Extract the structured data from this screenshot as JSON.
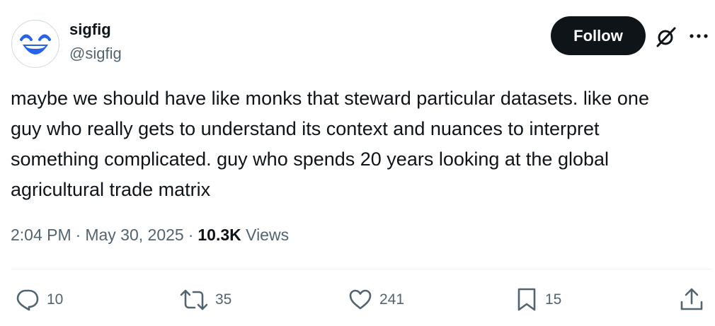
{
  "author": {
    "display_name": "sigfig",
    "handle": "@sigfig",
    "avatar_icon": "laughing-face-avatar"
  },
  "follow_button": {
    "label": "Follow"
  },
  "icons": {
    "grok": "grok-slash-circle-icon",
    "more": "more-dots-icon"
  },
  "tweet": {
    "lines": [
      "maybe we should have like monks that steward particular datasets. like one",
      "guy who really gets to understand its context and nuances to interpret",
      "something complicated. guy who spends 20 years looking at the global",
      "agricultural trade matrix"
    ]
  },
  "meta": {
    "time": "2:04 PM",
    "separator": "·",
    "date": "May 30, 2025",
    "views_count": "10.3K",
    "views_label": "Views"
  },
  "actions": {
    "reply_count": "10",
    "repost_count": "35",
    "like_count": "241",
    "bookmark_count": "15"
  },
  "colors": {
    "text_primary": "#0f1419",
    "text_secondary": "#536471",
    "follow_bg": "#0f1419",
    "avatar_blue": "#2563eb"
  }
}
